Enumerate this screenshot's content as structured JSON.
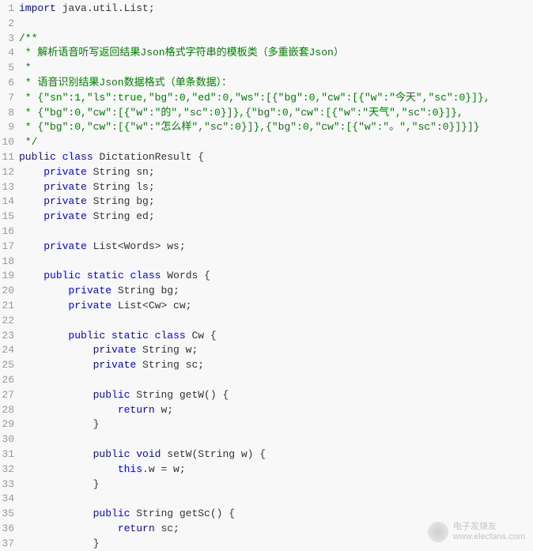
{
  "watermark": {
    "title": "电子发烧友",
    "url": "www.elecfans.com"
  },
  "lines": [
    {
      "n": 1,
      "tokens": [
        [
          "kw",
          "import"
        ],
        [
          "",
          " java.util.List;"
        ]
      ]
    },
    {
      "n": 2,
      "tokens": []
    },
    {
      "n": 3,
      "tokens": [
        [
          "comment",
          "/**"
        ]
      ]
    },
    {
      "n": 4,
      "tokens": [
        [
          "comment",
          " * 解析语音听写返回结果Json格式字符串的模板类（多重嵌套Json）"
        ]
      ]
    },
    {
      "n": 5,
      "tokens": [
        [
          "comment",
          " *"
        ]
      ]
    },
    {
      "n": 6,
      "tokens": [
        [
          "comment",
          " * 语音识别结果Json数据格式（单条数据）："
        ]
      ]
    },
    {
      "n": 7,
      "tokens": [
        [
          "comment",
          " * {\"sn\":1,\"ls\":true,\"bg\":0,\"ed\":0,\"ws\":[{\"bg\":0,\"cw\":[{\"w\":\"今天\",\"sc\":0}]},"
        ]
      ]
    },
    {
      "n": 8,
      "tokens": [
        [
          "comment",
          " * {\"bg\":0,\"cw\":[{\"w\":\"的\",\"sc\":0}]},{\"bg\":0,\"cw\":[{\"w\":\"天气\",\"sc\":0}]},"
        ]
      ]
    },
    {
      "n": 9,
      "tokens": [
        [
          "comment",
          " * {\"bg\":0,\"cw\":[{\"w\":\"怎么样\",\"sc\":0}]},{\"bg\":0,\"cw\":[{\"w\":\"。\",\"sc\":0}]}]}"
        ]
      ]
    },
    {
      "n": 10,
      "tokens": [
        [
          "comment",
          " */"
        ]
      ]
    },
    {
      "n": 11,
      "tokens": [
        [
          "kw",
          "public"
        ],
        [
          "",
          " "
        ],
        [
          "kw",
          "class"
        ],
        [
          "",
          " DictationResult {"
        ]
      ]
    },
    {
      "n": 12,
      "tokens": [
        [
          "",
          "    "
        ],
        [
          "kw",
          "private"
        ],
        [
          "",
          " String sn;"
        ]
      ]
    },
    {
      "n": 13,
      "tokens": [
        [
          "",
          "    "
        ],
        [
          "kw",
          "private"
        ],
        [
          "",
          " String ls;"
        ]
      ]
    },
    {
      "n": 14,
      "tokens": [
        [
          "",
          "    "
        ],
        [
          "kw",
          "private"
        ],
        [
          "",
          " String bg;"
        ]
      ]
    },
    {
      "n": 15,
      "tokens": [
        [
          "",
          "    "
        ],
        [
          "kw",
          "private"
        ],
        [
          "",
          " String ed;"
        ]
      ]
    },
    {
      "n": 16,
      "tokens": []
    },
    {
      "n": 17,
      "tokens": [
        [
          "",
          "    "
        ],
        [
          "kw",
          "private"
        ],
        [
          "",
          " List<Words> ws;"
        ]
      ]
    },
    {
      "n": 18,
      "tokens": []
    },
    {
      "n": 19,
      "tokens": [
        [
          "",
          "    "
        ],
        [
          "kw",
          "public"
        ],
        [
          "",
          " "
        ],
        [
          "kw",
          "static"
        ],
        [
          "",
          " "
        ],
        [
          "kw",
          "class"
        ],
        [
          "",
          " Words {"
        ]
      ]
    },
    {
      "n": 20,
      "tokens": [
        [
          "",
          "        "
        ],
        [
          "kw",
          "private"
        ],
        [
          "",
          " String bg;"
        ]
      ]
    },
    {
      "n": 21,
      "tokens": [
        [
          "",
          "        "
        ],
        [
          "kw",
          "private"
        ],
        [
          "",
          " List<Cw> cw;"
        ]
      ]
    },
    {
      "n": 22,
      "tokens": []
    },
    {
      "n": 23,
      "tokens": [
        [
          "",
          "        "
        ],
        [
          "kw",
          "public"
        ],
        [
          "",
          " "
        ],
        [
          "kw",
          "static"
        ],
        [
          "",
          " "
        ],
        [
          "kw",
          "class"
        ],
        [
          "",
          " Cw {"
        ]
      ]
    },
    {
      "n": 24,
      "tokens": [
        [
          "",
          "            "
        ],
        [
          "kw",
          "private"
        ],
        [
          "",
          " String w;"
        ]
      ]
    },
    {
      "n": 25,
      "tokens": [
        [
          "",
          "            "
        ],
        [
          "kw",
          "private"
        ],
        [
          "",
          " String sc;"
        ]
      ]
    },
    {
      "n": 26,
      "tokens": []
    },
    {
      "n": 27,
      "tokens": [
        [
          "",
          "            "
        ],
        [
          "kw",
          "public"
        ],
        [
          "",
          " String getW() {"
        ]
      ]
    },
    {
      "n": 28,
      "tokens": [
        [
          "",
          "                "
        ],
        [
          "kw",
          "return"
        ],
        [
          "",
          " w;"
        ]
      ]
    },
    {
      "n": 29,
      "tokens": [
        [
          "",
          "            }"
        ]
      ]
    },
    {
      "n": 30,
      "tokens": []
    },
    {
      "n": 31,
      "tokens": [
        [
          "",
          "            "
        ],
        [
          "kw",
          "public"
        ],
        [
          "",
          " "
        ],
        [
          "kw",
          "void"
        ],
        [
          "",
          " setW(String w) {"
        ]
      ]
    },
    {
      "n": 32,
      "tokens": [
        [
          "",
          "                "
        ],
        [
          "kw",
          "this"
        ],
        [
          "",
          ".w = w;"
        ]
      ]
    },
    {
      "n": 33,
      "tokens": [
        [
          "",
          "            }"
        ]
      ]
    },
    {
      "n": 34,
      "tokens": []
    },
    {
      "n": 35,
      "tokens": [
        [
          "",
          "            "
        ],
        [
          "kw",
          "public"
        ],
        [
          "",
          " String getSc() {"
        ]
      ]
    },
    {
      "n": 36,
      "tokens": [
        [
          "",
          "                "
        ],
        [
          "kw",
          "return"
        ],
        [
          "",
          " sc;"
        ]
      ]
    },
    {
      "n": 37,
      "tokens": [
        [
          "",
          "            }"
        ]
      ]
    }
  ]
}
